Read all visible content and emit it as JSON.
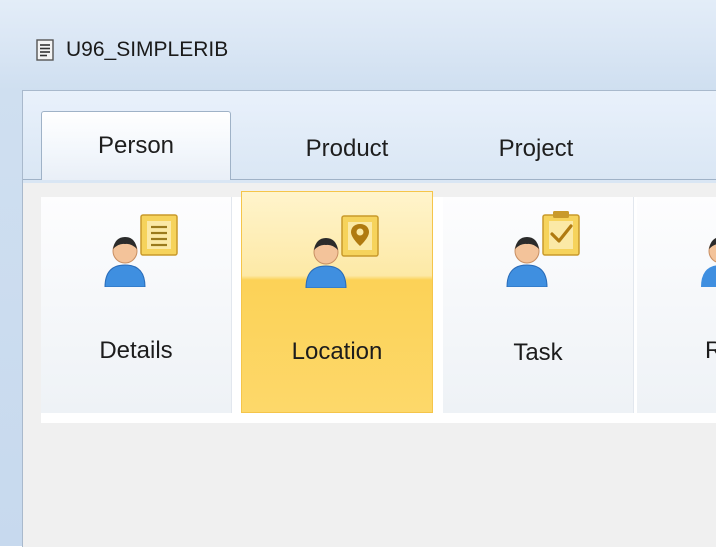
{
  "window": {
    "title": "U96_SIMPLERIB",
    "icon": "document-icon"
  },
  "tabs": [
    {
      "label": "Person",
      "active": true
    },
    {
      "label": "Product",
      "active": false
    },
    {
      "label": "Project",
      "active": false
    }
  ],
  "tiles": [
    {
      "label": "Details",
      "icon": "person-details-icon",
      "selected": false
    },
    {
      "label": "Location",
      "icon": "person-location-icon",
      "selected": true
    },
    {
      "label": "Task",
      "icon": "person-task-icon",
      "selected": false
    },
    {
      "label": "R",
      "icon": "person-icon",
      "selected": false
    }
  ],
  "colors": {
    "selection": "#fcd257",
    "person_skin": "#f3c39a",
    "person_body": "#3f8fe0",
    "badge": "#f2c640"
  }
}
